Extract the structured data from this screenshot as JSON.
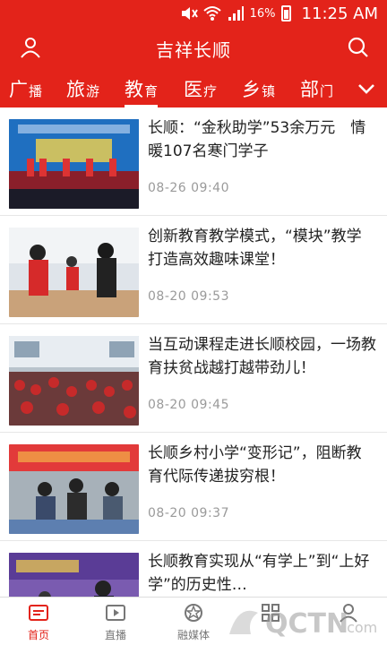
{
  "status_bar": {
    "battery": "16%",
    "time": "11:25 AM"
  },
  "header": {
    "title": "吉祥长顺"
  },
  "tabs": [
    {
      "big": "广",
      "small": "播"
    },
    {
      "big": "旅",
      "small": "游"
    },
    {
      "big": "教",
      "small": "育"
    },
    {
      "big": "医",
      "small": "疗"
    },
    {
      "big": "乡",
      "small": "镇"
    },
    {
      "big": "部",
      "small": "门"
    }
  ],
  "active_tab_index": 2,
  "news": [
    {
      "title": "长顺：“金秋助学”53余万元　情暖107名寒门学子",
      "date": "08-26  09:40"
    },
    {
      "title": "创新教育教学模式，“模块”教学打造高效趣味课堂！",
      "date": "08-20  09:53"
    },
    {
      "title": "当互动课程走进长顺校园，一场教育扶贫战越打越带劲儿！",
      "date": "08-20  09:45"
    },
    {
      "title": "长顺乡村小学“变形记”，阻断教育代际传递拔穷根！",
      "date": "08-20  09:37"
    },
    {
      "title": "长顺教育实现从“有学上”到“上好学”的历史性…",
      "date": ""
    }
  ],
  "bottom_nav": [
    {
      "label": "首页",
      "icon": "home-icon"
    },
    {
      "label": "直播",
      "icon": "live-icon"
    },
    {
      "label": "融媒体",
      "icon": "media-icon"
    },
    {
      "label": "",
      "icon": "grid-icon"
    },
    {
      "label": "",
      "icon": "profile-icon"
    }
  ],
  "colors": {
    "brand_red": "#e3231a"
  }
}
